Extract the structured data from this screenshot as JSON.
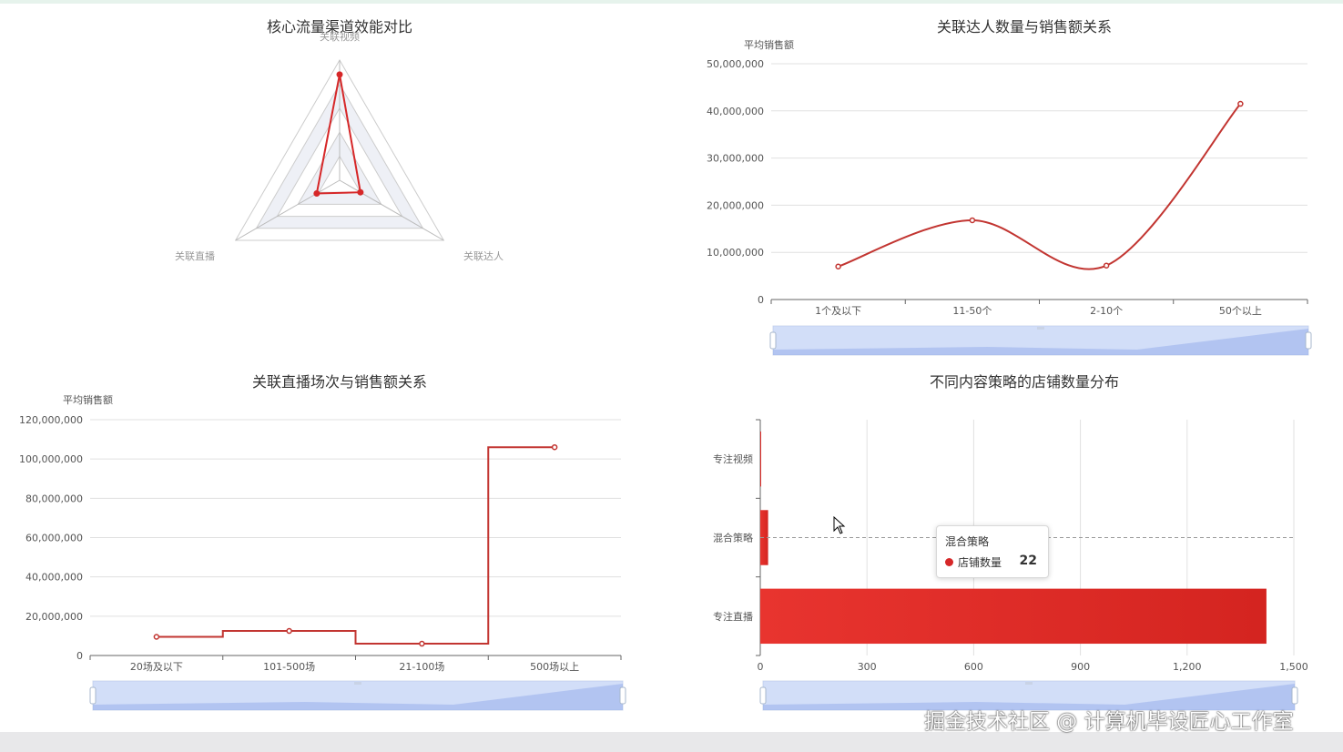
{
  "colors": {
    "series": "#d62728",
    "accent": "#c23531",
    "zoom": "#8fb0f7"
  },
  "chart_data": [
    {
      "type": "radar",
      "title": "核心流量渠道效能对比",
      "indicators": [
        "关联视频",
        "关联达人",
        "关联直播"
      ],
      "values": [
        0.88,
        0.2,
        0.22
      ],
      "max": 1
    },
    {
      "type": "line",
      "title": "关联达人数量与销售额关系",
      "ylabel": "平均销售额",
      "categories": [
        "1个及以下",
        "11-50个",
        "2-10个",
        "50个以上"
      ],
      "values": [
        7000000,
        16800000,
        7200000,
        41500000
      ],
      "ylim": [
        0,
        50000000
      ],
      "yticks": [
        "0",
        "10,000,000",
        "20,000,000",
        "30,000,000",
        "40,000,000",
        "50,000,000"
      ],
      "smooth": true
    },
    {
      "type": "line",
      "title": "关联直播场次与销售额关系",
      "ylabel": "平均销售额",
      "categories": [
        "20场及以下",
        "101-500场",
        "21-100场",
        "500场以上"
      ],
      "values": [
        9500000,
        12500000,
        6000000,
        106000000
      ],
      "ylim": [
        0,
        120000000
      ],
      "yticks": [
        "0",
        "20,000,000",
        "40,000,000",
        "60,000,000",
        "80,000,000",
        "100,000,000",
        "120,000,000"
      ],
      "step": "middle"
    },
    {
      "type": "bar",
      "orientation": "horizontal",
      "title": "不同内容策略的店铺数量分布",
      "categories": [
        "专注视频",
        "混合策略",
        "专注直播"
      ],
      "series": [
        {
          "name": "店铺数量",
          "values": [
            2,
            22,
            1423
          ]
        }
      ],
      "xlim": [
        0,
        1500
      ],
      "xticks": [
        "0",
        "300",
        "600",
        "900",
        "1,200",
        "1,500"
      ]
    }
  ],
  "tooltip": {
    "title": "混合策略",
    "label": "店铺数量",
    "value": "22"
  },
  "watermark": "掘金技术社区 @ 计算机毕设匠心工作室"
}
